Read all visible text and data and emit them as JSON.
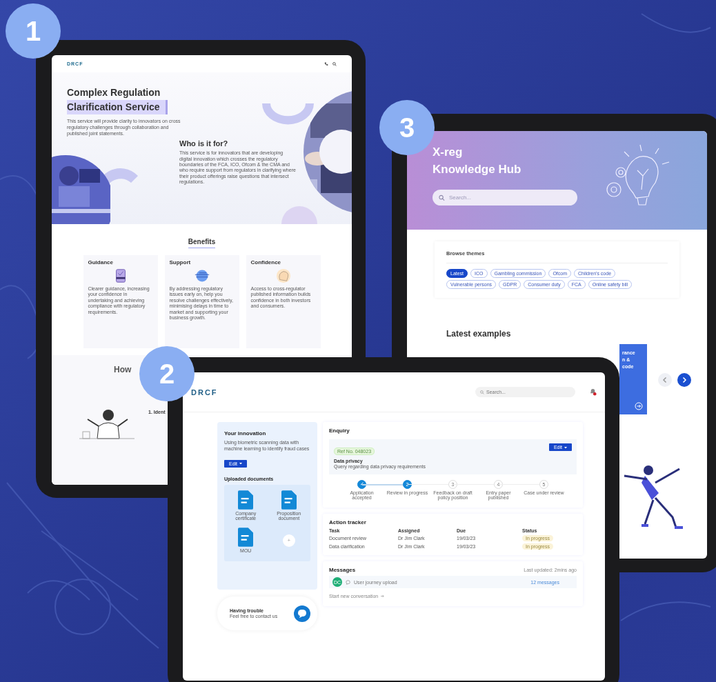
{
  "badges": [
    "1",
    "2",
    "3"
  ],
  "site_page": {
    "logo": "DRCF",
    "title_line1": "Complex Regulation",
    "title_line2": "Clarification Service",
    "intro": "This service will provide clarity to innovators on cross regulatory challenges through collaboration and published joint statements.",
    "who_heading": "Who is it for?",
    "who_text": "This service is for innovators that are developing digital innovation which crosses the regulatory boundaries of the FCA, ICO, Ofcom & the CMA and who require support from regulators in clarifying where their product offerings raise questions that intersect regulations.",
    "benefits_heading": "Benefits",
    "benefits": [
      {
        "title": "Guidance",
        "kind": "clipboard",
        "text": "Clearer guidance, increasing your confidence in undertaking and achieving compliance with regulatory requirements."
      },
      {
        "title": "Support",
        "kind": "globe",
        "text": "By addressing regulatory issues early on, help you resolve challenges effectively, minimising delays in time to market and supporting your business growth."
      },
      {
        "title": "Confidence",
        "kind": "head",
        "text": "Access to cross-regulator published information builds confidence in both investors and consumers."
      }
    ],
    "how_heading": "How",
    "step_fragment": "1. Ident"
  },
  "knowledge_hub": {
    "title_line1": "X-reg",
    "title_line2": "Knowledge Hub",
    "search": {
      "placeholder": "Search..."
    },
    "browse_heading": "Browse themes",
    "themes": [
      {
        "label": "Latest",
        "selected": true
      },
      {
        "label": "ICO",
        "selected": false
      },
      {
        "label": "Gambling commission",
        "selected": false
      },
      {
        "label": "Ofcom",
        "selected": false
      },
      {
        "label": "Children's code",
        "selected": false
      },
      {
        "label": "Vulnerable persons",
        "selected": false
      },
      {
        "label": "GDPR",
        "selected": false
      },
      {
        "label": "Consumer duty",
        "selected": false
      },
      {
        "label": "FCA",
        "selected": false
      },
      {
        "label": "Online safety bill",
        "selected": false
      }
    ],
    "latest_heading": "Latest examples",
    "card_fragments": [
      "rance",
      "n &",
      "code"
    ]
  },
  "dashboard": {
    "logo": "DRCF",
    "search": {
      "placeholder": "Search..."
    },
    "innovation": {
      "heading": "Your innovation",
      "text": "Using biometric scanning data with machine learning to identify fraud cases",
      "edit": "Edit"
    },
    "documents": {
      "heading": "Uploaded documents",
      "files": [
        "Company certificate",
        "Proposition document",
        "MOU"
      ],
      "add": "+"
    },
    "help": {
      "title": "Having trouble",
      "text": "Feel free to contact us"
    },
    "enquiry": {
      "heading": "Enquiry",
      "ref": "Ref No. 048023",
      "topic": "Data privacy",
      "text": "Query regarding data privacy requirements",
      "edit": "Edit",
      "steps": [
        {
          "mark": "✓",
          "label": "Application accepted",
          "reached": true
        },
        {
          "mark": "2",
          "label": "Review in progress",
          "reached": true
        },
        {
          "mark": "3",
          "label": "Feedback on draft policy position",
          "reached": false
        },
        {
          "mark": "4",
          "label": "Entry paper published",
          "reached": false
        },
        {
          "mark": "5",
          "label": "Case under review",
          "reached": false
        }
      ]
    },
    "tracker": {
      "heading": "Action tracker",
      "columns": [
        "Task",
        "Assigned",
        "Due",
        "Status"
      ],
      "rows": [
        [
          "Document review",
          "Dr Jim Clark",
          "19/03/23",
          "In progress"
        ],
        [
          "Data clarification",
          "Dr Jim Clark",
          "19/03/23",
          "In progress"
        ]
      ]
    },
    "messages": {
      "heading": "Messages",
      "updated": "Last updated: 2mins ago",
      "initials": "DC",
      "topic": "User journey upload",
      "count": "12 messages",
      "new_link": "Start new conversation"
    }
  }
}
